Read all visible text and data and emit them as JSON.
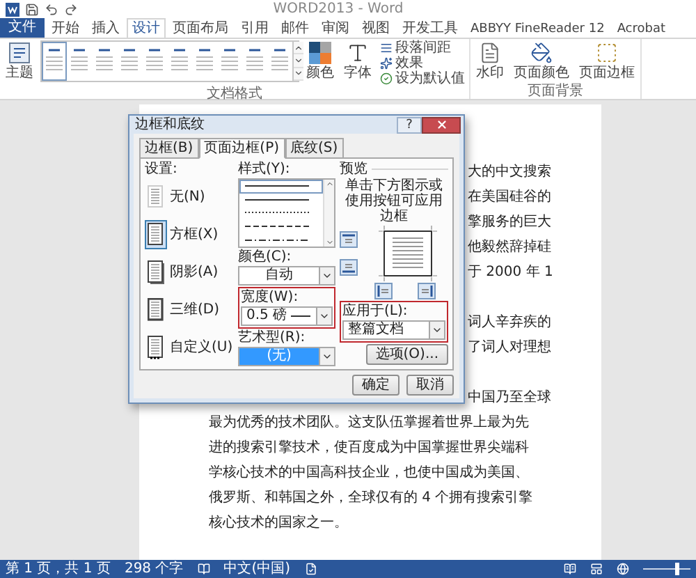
{
  "window": {
    "title": "WORD2013 - Word"
  },
  "ribbon": {
    "file_tab": "文件",
    "tabs": [
      {
        "label": "开始",
        "selected": false
      },
      {
        "label": "插入",
        "selected": false
      },
      {
        "label": "设计",
        "selected": true
      },
      {
        "label": "页面布局",
        "selected": false
      },
      {
        "label": "引用",
        "selected": false
      },
      {
        "label": "邮件",
        "selected": false
      },
      {
        "label": "审阅",
        "selected": false
      },
      {
        "label": "视图",
        "selected": false
      },
      {
        "label": "开发工具",
        "selected": false
      },
      {
        "label": "ABBYY FineReader 12",
        "selected": false
      },
      {
        "label": "Acrobat",
        "selected": false
      }
    ],
    "groups": [
      {
        "label": "文档格式",
        "items": [
          {
            "kind": "large",
            "label": "主题"
          },
          {
            "kind": "gallery",
            "styles": [
              {
                "selected": true
              },
              {
                "selected": false
              },
              {
                "selected": false
              },
              {
                "selected": false
              },
              {
                "selected": false
              },
              {
                "selected": false
              },
              {
                "selected": false
              },
              {
                "selected": false
              },
              {
                "selected": false
              },
              {
                "selected": false
              }
            ]
          },
          {
            "kind": "large",
            "label": "颜色"
          },
          {
            "kind": "large",
            "label": "字体"
          },
          {
            "kind": "stack",
            "items": [
              {
                "label": "段落间距"
              },
              {
                "label": "效果"
              },
              {
                "label": "设为默认值"
              }
            ]
          }
        ]
      },
      {
        "label": "页面背景",
        "items": [
          {
            "kind": "large",
            "label": "水印"
          },
          {
            "kind": "large",
            "label": "页面颜色"
          },
          {
            "kind": "large",
            "label": "页面边框"
          }
        ]
      }
    ]
  },
  "document": {
    "lines": [
      {
        "kind": "partial",
        "text": "大的中文搜索"
      },
      {
        "kind": "partial",
        "text": "在美国硅谷的"
      },
      {
        "kind": "partial",
        "text": "擎服务的巨大"
      },
      {
        "kind": "partial",
        "text": "他毅然辞掉硅"
      },
      {
        "kind": "partial",
        "text": "于 2000 年 1"
      },
      {
        "kind": "blank"
      },
      {
        "kind": "partial",
        "text": "词人辛弃疾的"
      },
      {
        "kind": "partial",
        "text": "了词人对理想"
      },
      {
        "kind": "blank"
      },
      {
        "kind": "partial",
        "text": "中国乃至全球"
      },
      {
        "kind": "full",
        "text": "最为优秀的技术团队。这支队伍掌握着世界上最为先"
      },
      {
        "kind": "full",
        "text": "进的搜索引擎技术，使百度成为中国掌握世界尖端科"
      },
      {
        "kind": "full",
        "text": "学核心技术的中国高科技企业，也使中国成为美国、"
      },
      {
        "kind": "full",
        "text": "俄罗斯、和韩国之外，全球仅有的 4 个拥有搜索引擎"
      },
      {
        "kind": "full",
        "text": "核心技术的国家之一。"
      }
    ]
  },
  "dialog": {
    "title": "边框和底纹",
    "help_button": "?",
    "tabs": [
      {
        "label": "边框(B)",
        "selected": false
      },
      {
        "label": "页面边框(P)",
        "selected": true
      },
      {
        "label": "底纹(S)",
        "selected": false
      }
    ],
    "settings": {
      "label": "设置:",
      "items": [
        {
          "kind": "none",
          "label": "无(N)",
          "selected": false
        },
        {
          "kind": "box",
          "label": "方框(X)",
          "selected": true
        },
        {
          "kind": "shadow",
          "label": "阴影(A)",
          "selected": false
        },
        {
          "kind": "threed",
          "label": "三维(D)",
          "selected": false
        },
        {
          "kind": "custom",
          "label": "自定义(U)",
          "selected": false
        }
      ]
    },
    "style": {
      "label": "样式(Y):",
      "options": [
        {
          "kind": "solid",
          "selected": true
        },
        {
          "kind": "solid",
          "selected": false
        },
        {
          "kind": "dotted",
          "selected": false
        },
        {
          "kind": "dashed",
          "selected": false
        },
        {
          "kind": "dashdot",
          "selected": false
        }
      ]
    },
    "color": {
      "label": "颜色(C):",
      "value": "自动"
    },
    "width": {
      "label": "宽度(W):",
      "value": "0.5 磅",
      "highlighted": true
    },
    "art": {
      "label": "艺术型(R):",
      "value": "(无)"
    },
    "preview": {
      "label": "预览",
      "hint": "单击下方图示或使用按钮可应用边框"
    },
    "apply_to": {
      "label": "应用于(L):",
      "value": "整篇文档",
      "highlighted": true
    },
    "options_button": "选项(O)...",
    "ok_button": "确定",
    "cancel_button": "取消"
  },
  "status_bar": {
    "page": "第 1 页，共 1 页",
    "words": "298 个字",
    "language": "中文(中国)",
    "zoom": {
      "level": 0.7
    }
  }
}
